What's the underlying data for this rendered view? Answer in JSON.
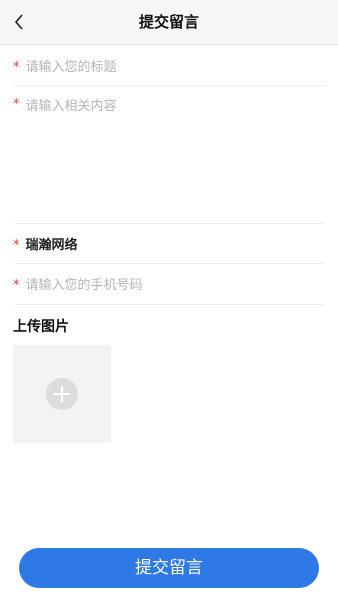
{
  "header": {
    "title": "提交留言",
    "back_icon": "chevron-left-icon"
  },
  "form": {
    "required_mark": "*",
    "title_field": {
      "placeholder": "请输入您的标题"
    },
    "content_field": {
      "placeholder": "请输入相关内容"
    },
    "company_field": {
      "value": "瑞瀚网络"
    },
    "phone_field": {
      "placeholder": "请输入您的手机号码"
    },
    "upload": {
      "label": "上传图片",
      "add_icon": "plus-circle-icon"
    },
    "submit_label": "提交留言"
  },
  "colors": {
    "accent": "#2f79e6",
    "required": "#e23b3b",
    "placeholder": "#b4b4b4"
  }
}
